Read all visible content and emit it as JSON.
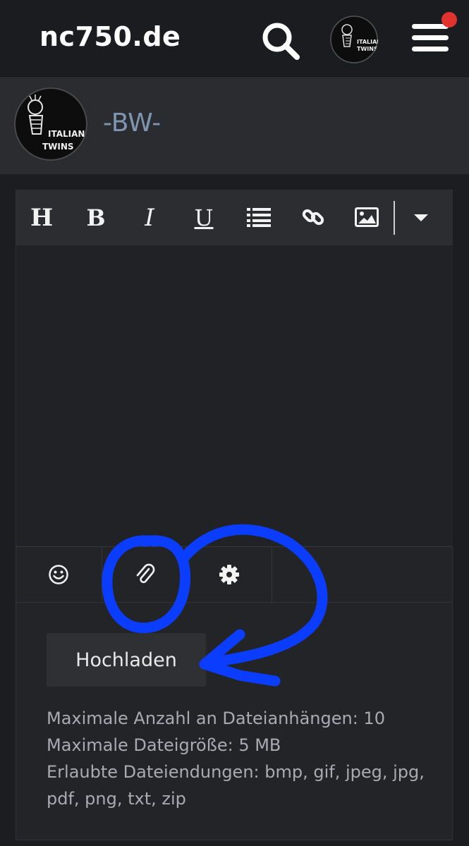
{
  "header": {
    "site_title": "nc750.de",
    "search_icon": "search-icon",
    "menu_icon": "hamburger-menu-icon",
    "notification_color": "#e0322f"
  },
  "profile": {
    "name": "-BW-",
    "avatar_text_line1": "ITALIAN",
    "avatar_text_line2": "TWINS"
  },
  "editor": {
    "toolbar": [
      "H",
      "B",
      "I",
      "U",
      "list-icon",
      "link-icon",
      "image-icon",
      "chevron-down-icon"
    ],
    "bottom_toolbar": [
      "smiley-icon",
      "paperclip-icon",
      "gear-icon"
    ],
    "upload_label": "Hochladen",
    "info": {
      "max_attachments": "Maximale Anzahl an Dateianhängen: 10",
      "max_size": "Maximale Dateigröße: 5 MB",
      "allowed_ext_line1": "Erlaubte Dateiendungen: bmp, gif, jpeg, jpg,",
      "allowed_ext_line2": "pdf, png, txt, zip"
    }
  },
  "colors": {
    "background": "#1c1d20",
    "profile_bar": "#2a2c30",
    "accent_blue": "#0b3dff",
    "username": "#7f96b3"
  }
}
